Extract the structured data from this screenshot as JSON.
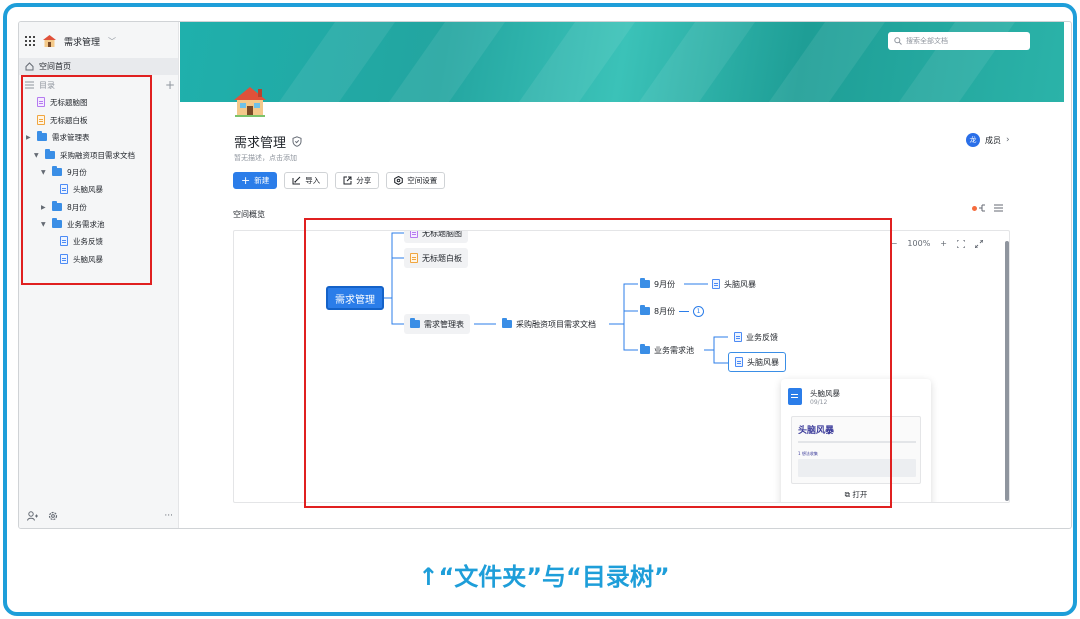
{
  "sidebar": {
    "space_title": "需求管理",
    "home_label": "空间首页",
    "directory_label": "目录",
    "tree": [
      {
        "label": "无标题脑图",
        "kind": "mind",
        "depth": 0,
        "expanded": null
      },
      {
        "label": "无标题白板",
        "kind": "board",
        "depth": 0,
        "expanded": null
      },
      {
        "label": "需求管理表",
        "kind": "folder",
        "depth": 0,
        "expanded": true
      },
      {
        "label": "采购融资项目需求文档",
        "kind": "folder",
        "depth": 1,
        "expanded": true
      },
      {
        "label": "9月份",
        "kind": "folder",
        "depth": 2,
        "expanded": true
      },
      {
        "label": "头脑风暴",
        "kind": "doc",
        "depth": 3,
        "expanded": null
      },
      {
        "label": "8月份",
        "kind": "folder",
        "depth": 2,
        "expanded": false
      },
      {
        "label": "业务需求池",
        "kind": "folder",
        "depth": 2,
        "expanded": true
      },
      {
        "label": "业务反馈",
        "kind": "doc",
        "depth": 3,
        "expanded": null
      },
      {
        "label": "头脑风暴",
        "kind": "doc",
        "depth": 3,
        "expanded": null
      }
    ],
    "footer_more": "···"
  },
  "header": {
    "search_placeholder": "搜索全部文档",
    "page_title": "需求管理",
    "description": "暂无描述，点击添加",
    "avatar_text": "龙",
    "members_label": "成员"
  },
  "toolbar": {
    "new_label": "新建",
    "import_label": "导入",
    "share_label": "分享",
    "settings_label": "空间设置"
  },
  "overview": {
    "title": "空间概览",
    "zoom_level": "100%",
    "zoom_minus": "−",
    "zoom_plus": "+"
  },
  "mindmap": {
    "root": "需求管理",
    "n_mind": "无标题脑图",
    "n_board": "无标题白板",
    "n_table": "需求管理表",
    "n_doc": "采购融资项目需求文档",
    "n_sep": "9月份",
    "n_sep_child": "头脑风暴",
    "n_aug": "8月份",
    "n_aug_badge": "1",
    "n_pool": "业务需求池",
    "n_feedback": "业务反馈",
    "n_brain": "头脑风暴"
  },
  "preview": {
    "title": "头脑风暴",
    "date": "09/12",
    "thumb_heading": "头脑风暴",
    "thumb_sub": "1 想法收集",
    "open_label": "打开"
  },
  "caption": "↑“文件夹”与“目录树”",
  "colors": {
    "accent": "#2b7de9",
    "highlight_box": "#e02020",
    "caption": "#1e9ed9",
    "banner": "#23a5a0"
  }
}
